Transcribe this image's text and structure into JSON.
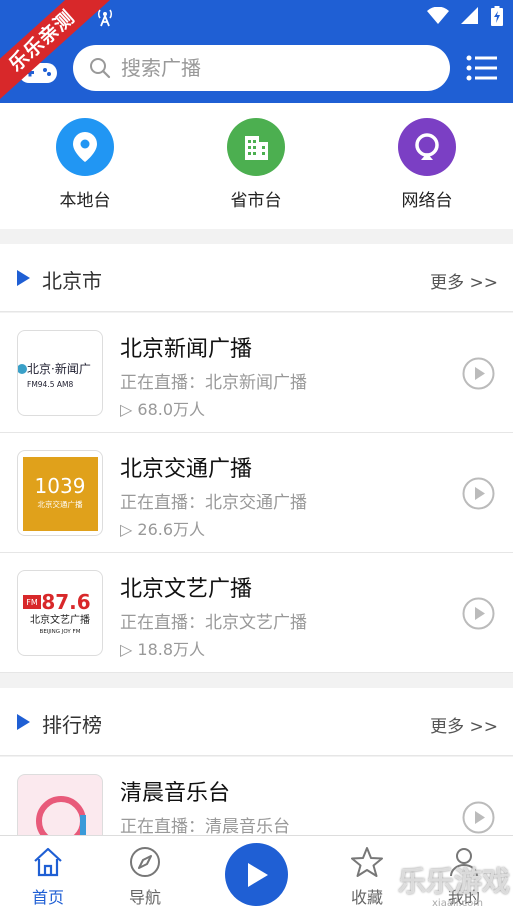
{
  "colors": {
    "primary": "#1f5fd4",
    "ribbon": "#d8282a",
    "local": "#2196f3",
    "province": "#4caf50",
    "network": "#7b3fc4"
  },
  "promo_ribbon": "乐乐亲测",
  "search": {
    "placeholder": "搜索广播"
  },
  "categories": [
    {
      "label": "本地台",
      "icon": "location-pin-icon"
    },
    {
      "label": "省市台",
      "icon": "building-icon"
    },
    {
      "label": "网络台",
      "icon": "network-icon"
    }
  ],
  "sections": [
    {
      "title": "北京市",
      "more": "更多 >>",
      "stations": [
        {
          "name": "北京新闻广播",
          "live": "正在直播：北京新闻广播",
          "listeners": "68.0万人",
          "logo_text": "北京·新闻广",
          "logo_sub": "FM94.5  AM8"
        },
        {
          "name": "北京交通广播",
          "live": "正在直播：北京交通广播",
          "listeners": "26.6万人",
          "logo_text": "1039",
          "logo_sub": "北京交通广播"
        },
        {
          "name": "北京文艺广播",
          "live": "正在直播：北京文艺广播",
          "listeners": "18.8万人",
          "logo_text": "87.6",
          "logo_sub": "BEIJING  JOY  FM"
        }
      ]
    },
    {
      "title": "排行榜",
      "more": "更多 >>",
      "stations": [
        {
          "name": "清晨音乐台",
          "live": "正在直播：清晨音乐台",
          "listeners": "",
          "logo_text": "",
          "logo_sub": ""
        }
      ]
    }
  ],
  "bottom_nav": [
    {
      "label": "首页",
      "icon": "home-icon",
      "active": true
    },
    {
      "label": "导航",
      "icon": "compass-icon",
      "active": false
    },
    {
      "label": "收藏",
      "icon": "star-icon",
      "active": false
    },
    {
      "label": "我的",
      "icon": "user-icon",
      "active": false
    }
  ],
  "watermark": "乐乐游戏",
  "watermark_sub": "xiaall.com"
}
